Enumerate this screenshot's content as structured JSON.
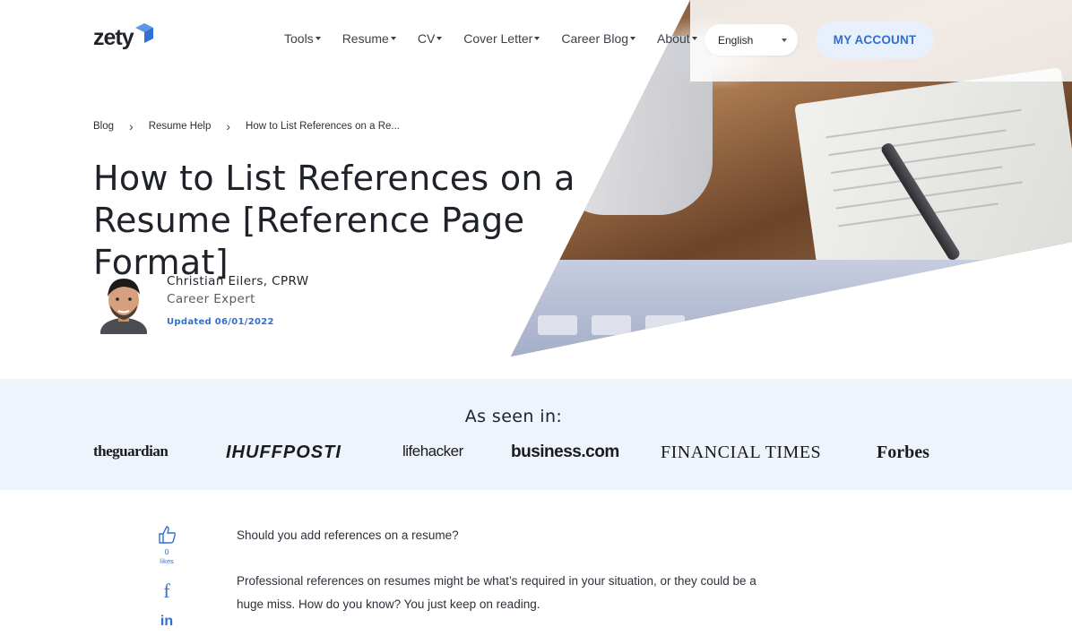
{
  "header": {
    "logo": "zety",
    "nav": [
      {
        "label": "Tools"
      },
      {
        "label": "Resume"
      },
      {
        "label": "CV"
      },
      {
        "label": "Cover Letter"
      },
      {
        "label": "Career Blog"
      },
      {
        "label": "About"
      }
    ],
    "language": "English",
    "account_button": "MY ACCOUNT"
  },
  "breadcrumb": [
    "Blog",
    "Resume Help",
    "How to List References on a Re..."
  ],
  "article": {
    "title": "How to List References on a Resume [Reference Page Format]",
    "author_name": "Christian Eilers, CPRW",
    "author_role": "Career Expert",
    "updated": "Updated 06/01/2022"
  },
  "seen_in": {
    "title": "As seen in:",
    "brands": [
      "theguardian",
      "IHUFFPOSTI",
      "lifehacker",
      "business.com",
      "FINANCIAL TIMES",
      "Forbes"
    ]
  },
  "share": {
    "likes_count": "0",
    "likes_label": "likes"
  },
  "body": {
    "paragraph1": "Should you add references on a resume?",
    "paragraph2": "Professional references on resumes might be what’s required in your situation, or they could be a huge miss. How do you know? You just keep on reading."
  },
  "colors": {
    "accent": "#2f6fd6",
    "band": "#eef4fb",
    "text": "#1f2229"
  }
}
